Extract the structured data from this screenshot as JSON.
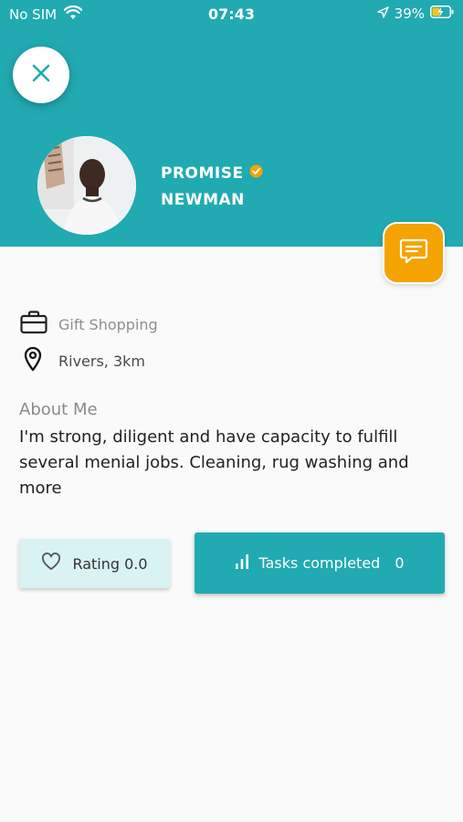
{
  "status_bar": {
    "carrier": "No SIM",
    "time": "07:43",
    "battery": "39%",
    "icons": [
      "wifi-icon",
      "location-arrow-icon",
      "battery-charging-icon"
    ]
  },
  "profile": {
    "first_name": "PROMISE",
    "last_name": "NEWMAN",
    "verified": true,
    "category": "Gift Shopping",
    "location": "Rivers, 3km",
    "about_title": "About Me",
    "about_text": "I'm strong, diligent and have capacity to fulfill several menial jobs. Cleaning, rug washing and more"
  },
  "stats": {
    "rating_label": "Rating 0.0",
    "tasks_label": "Tasks completed",
    "tasks_count": "0"
  },
  "colors": {
    "primary": "#21aab1",
    "accent": "#f5a300",
    "rating_bg": "#d9f2f4",
    "verified_badge": "#f5a300"
  },
  "icons": {
    "close": "close-icon",
    "chat": "chat-icon",
    "category": "briefcase-icon",
    "location": "map-pin-icon",
    "rating": "heart-icon",
    "tasks": "bar-chart-icon"
  }
}
